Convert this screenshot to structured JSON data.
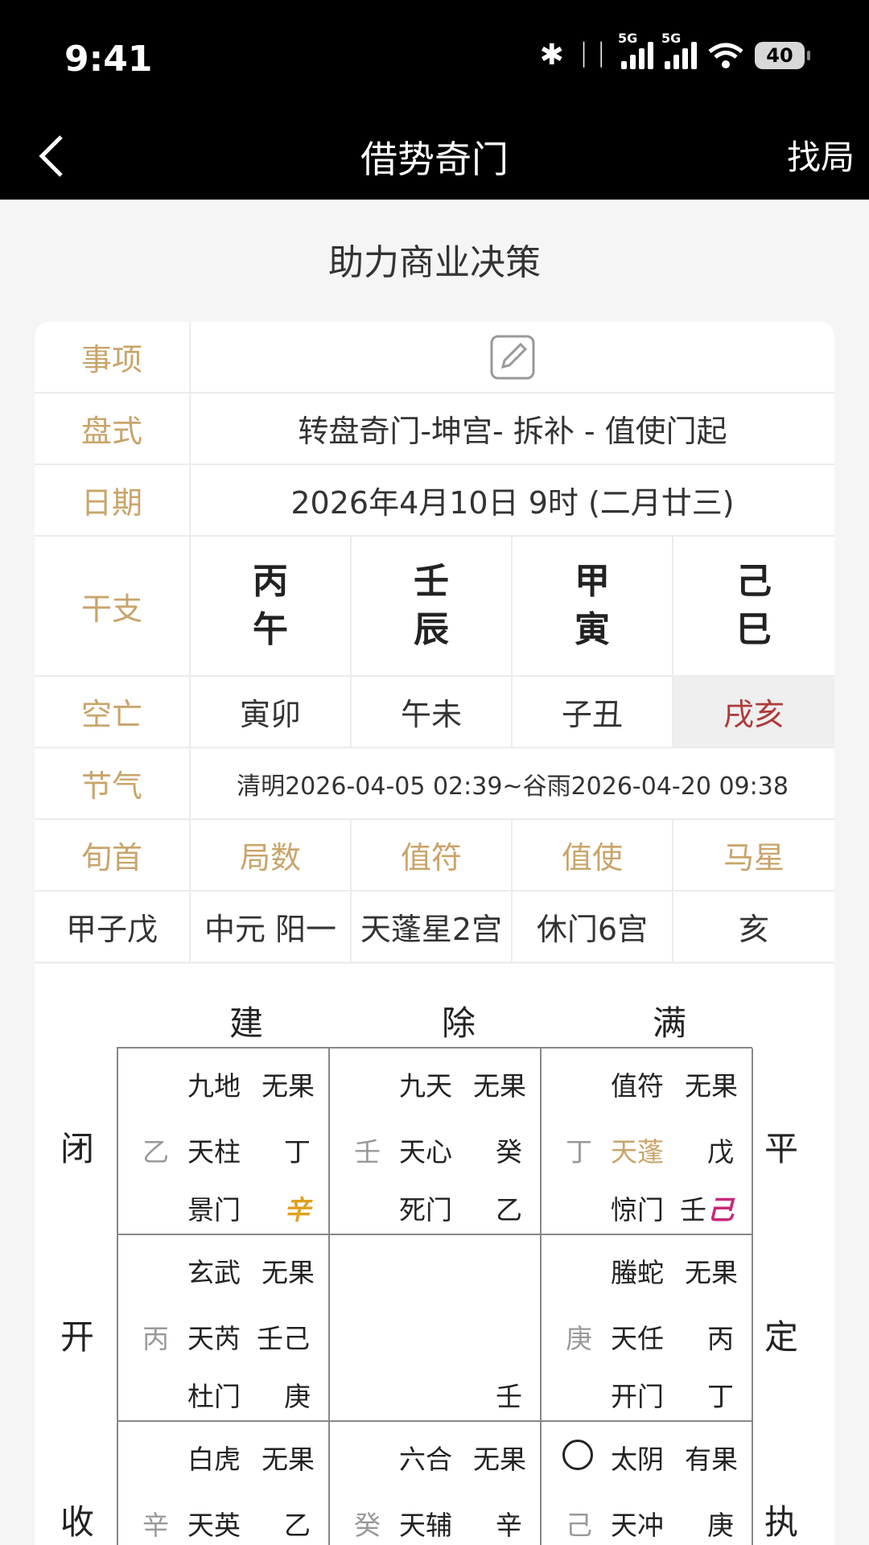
{
  "status": {
    "time": "9:41",
    "battery": "40",
    "network1": "5G",
    "network2": "5G"
  },
  "nav": {
    "title": "借势奇门",
    "right": "找局"
  },
  "subtitle": "助力商业决策",
  "info": {
    "labels": {
      "item": "事项",
      "pan": "盘式",
      "date": "日期",
      "ganzhi": "干支",
      "kongwang": "空亡",
      "jieqi": "节气",
      "xunshou": "旬首"
    },
    "pan_value": "转盘奇门-坤宫- 拆补 - 值使门起",
    "date_value": "2026年4月10日 9时 (二月廿三)",
    "ganzhi": [
      {
        "top": "丙",
        "bottom": "午"
      },
      {
        "top": "壬",
        "bottom": "辰"
      },
      {
        "top": "甲",
        "bottom": "寅"
      },
      {
        "top": "己",
        "bottom": "巳"
      }
    ],
    "kongwang": [
      "寅卯",
      "午未",
      "子丑",
      "戌亥"
    ],
    "jieqi_value": "清明2026-04-05 02:39~谷雨2026-04-20 09:38",
    "headers": [
      "局数",
      "值符",
      "值使",
      "马星"
    ],
    "values": [
      "甲子戊",
      "中元 阳一",
      "天蓬星2宫",
      "休门6宫",
      "亥"
    ]
  },
  "grid": {
    "top": [
      "建",
      "除",
      "满"
    ],
    "left": [
      "闭",
      "开",
      "收"
    ],
    "right": [
      "平",
      "定",
      "执"
    ],
    "palaces": [
      {
        "god": "九地",
        "fruit": "无果",
        "left": "乙",
        "star": "天柱",
        "right": "丁",
        "door": "景门",
        "door_right": "辛"
      },
      {
        "god": "九天",
        "fruit": "无果",
        "left": "壬",
        "star": "天心",
        "right": "癸",
        "door": "死门",
        "door_right": "乙"
      },
      {
        "god": "值符",
        "fruit": "无果",
        "left": "丁",
        "star": "天蓬",
        "right": "戊",
        "door": "惊门",
        "door_right_a": "壬",
        "door_right_b": "己"
      },
      {
        "god": "玄武",
        "fruit": "无果",
        "left": "丙",
        "star": "天芮",
        "right": "壬己",
        "door": "杜门",
        "door_right": "庚"
      },
      {
        "door_right": "壬"
      },
      {
        "god": "螣蛇",
        "fruit": "无果",
        "left": "庚",
        "star": "天任",
        "right": "丙",
        "door": "开门",
        "door_right": "丁"
      },
      {
        "god": "白虎",
        "fruit": "无果",
        "left": "辛",
        "star": "天英",
        "right": "乙"
      },
      {
        "god": "六合",
        "fruit": "无果",
        "left": "癸",
        "star": "天辅",
        "right": "辛"
      },
      {
        "god": "太阴",
        "fruit": "有果",
        "left": "己",
        "star": "天冲",
        "right": "庚"
      }
    ]
  }
}
